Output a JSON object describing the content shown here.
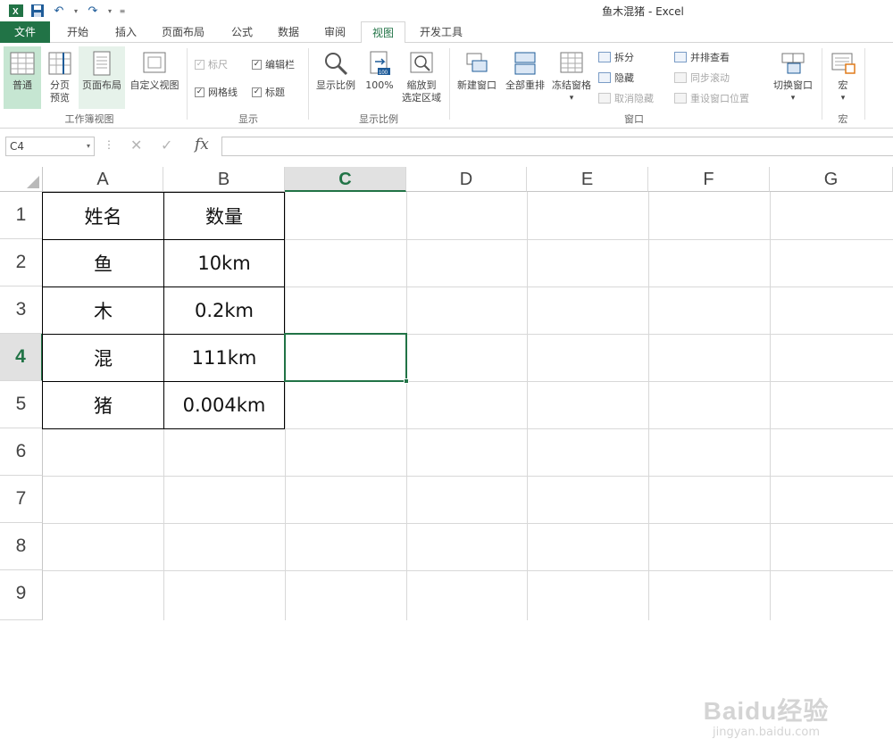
{
  "window": {
    "title": "鱼木混猪 - Excel"
  },
  "tabs": [
    "文件",
    "开始",
    "插入",
    "页面布局",
    "公式",
    "数据",
    "审阅",
    "视图",
    "开发工具"
  ],
  "active_tab": "视图",
  "ribbon": {
    "workbook_views": {
      "label": "工作簿视图",
      "normal": "普通",
      "page_break_1": "分页",
      "page_break_2": "预览",
      "page_layout": "页面布局",
      "custom_views": "自定义视图"
    },
    "show": {
      "label": "显示",
      "ruler": "标尺",
      "formula_bar": "编辑栏",
      "gridlines": "网格线",
      "headings": "标题"
    },
    "zoom": {
      "label": "显示比例",
      "zoom": "显示比例",
      "hundred": "100%",
      "zoom_sel_1": "缩放到",
      "zoom_sel_2": "选定区域"
    },
    "window": {
      "label": "窗口",
      "new_window": "新建窗口",
      "arrange_all": "全部重排",
      "freeze_panes": "冻结窗格",
      "split": "拆分",
      "hide": "隐藏",
      "unhide": "取消隐藏",
      "side_by_side": "并排查看",
      "sync_scroll": "同步滚动",
      "reset_pos": "重设窗口位置",
      "switch_windows": "切换窗口"
    },
    "macros": {
      "label": "宏",
      "macros": "宏"
    }
  },
  "formula_bar": {
    "name_box": "C4",
    "fx": "fx",
    "value": ""
  },
  "columns": [
    "A",
    "B",
    "C",
    "D",
    "E",
    "F",
    "G"
  ],
  "rows": [
    "1",
    "2",
    "3",
    "4",
    "5",
    "6",
    "7",
    "8",
    "9"
  ],
  "active_cell": "C4",
  "cells": {
    "A1": "姓名",
    "B1": "数量",
    "A2": "鱼",
    "B2": "10km",
    "A3": "木",
    "B3": "0.2km",
    "A4": "混",
    "B4": "111km",
    "A5": "猪",
    "B5": "0.004km"
  },
  "watermark": {
    "line1": "Baidu经验",
    "line2": "jingyan.baidu.com"
  },
  "colors": {
    "excel_green": "#217346",
    "selected_header_bg": "#e1e1e1"
  }
}
